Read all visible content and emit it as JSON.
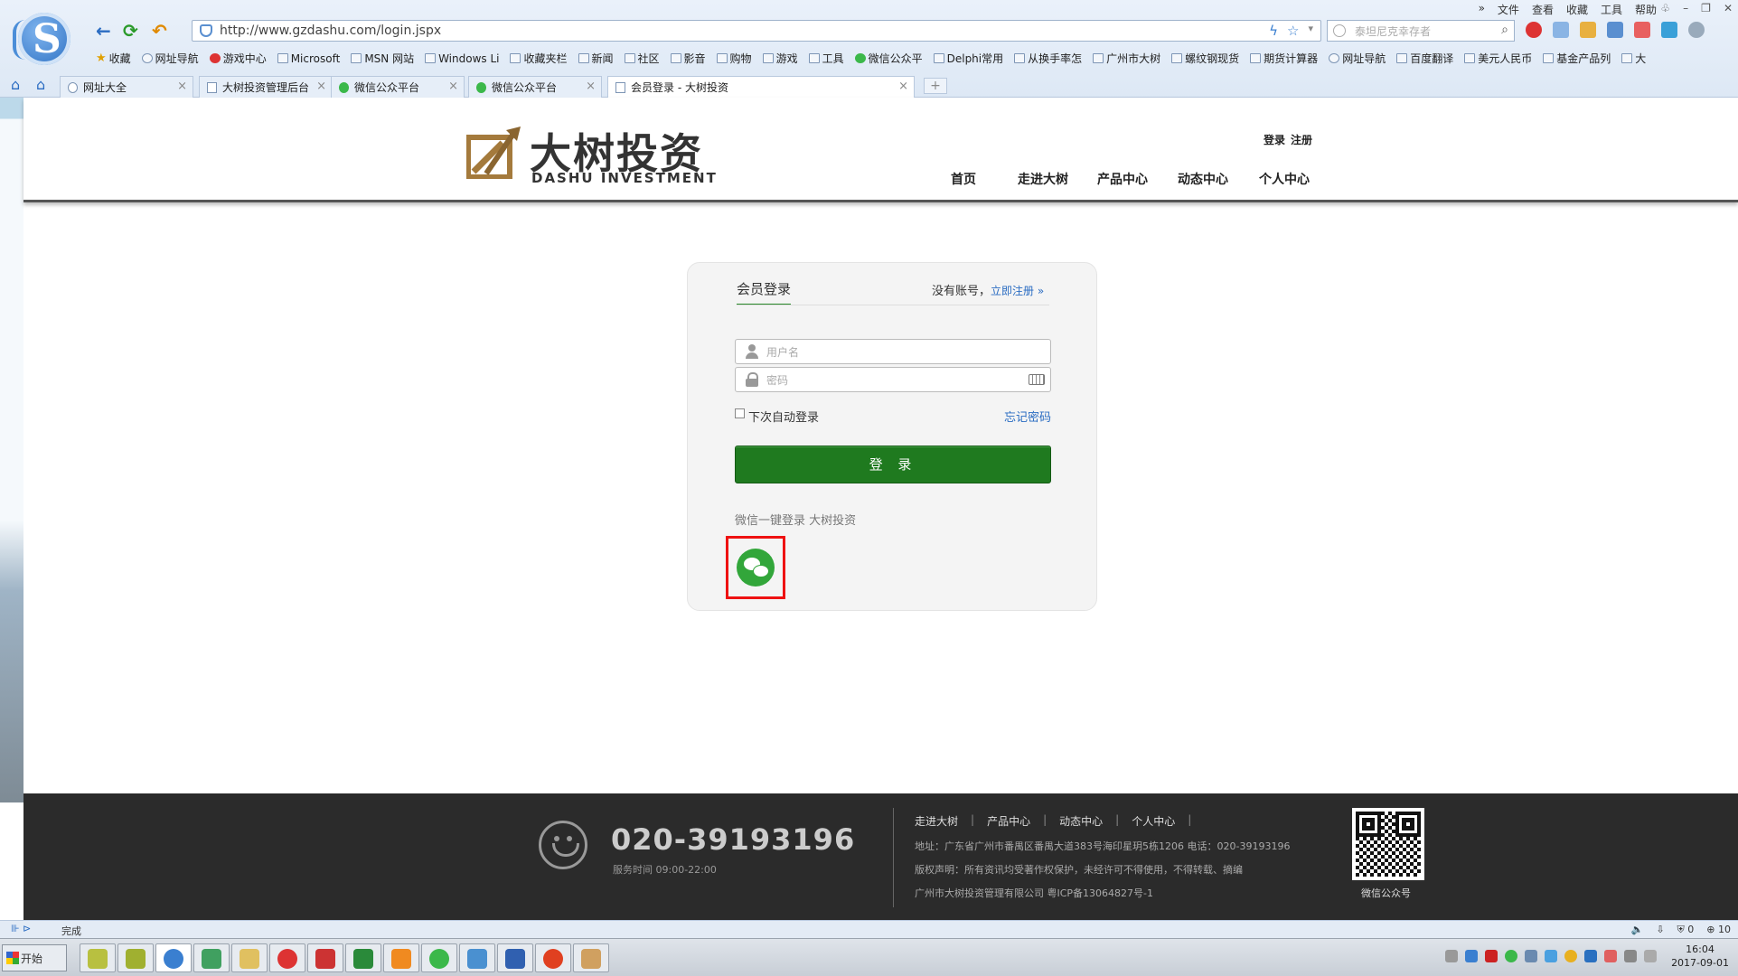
{
  "browser": {
    "menu": [
      "»",
      "文件",
      "查看",
      "收藏",
      "工具",
      "帮助"
    ],
    "url": "http://www.gzdashu.com/login.jspx",
    "search_placeholder": "泰坦尼克幸存者",
    "favorites": [
      {
        "label": "收藏",
        "icon": "star-icon"
      },
      {
        "label": "网址导航",
        "icon": "globe-icon"
      },
      {
        "label": "游戏中心",
        "icon": "game-icon"
      },
      {
        "label": "Microsoft",
        "icon": "folder-icon"
      },
      {
        "label": "MSN 网站",
        "icon": "folder-icon"
      },
      {
        "label": "Windows Li",
        "icon": "folder-icon"
      },
      {
        "label": "收藏夹栏",
        "icon": "folder-icon"
      },
      {
        "label": "新闻",
        "icon": "folder-icon"
      },
      {
        "label": "社区",
        "icon": "folder-icon"
      },
      {
        "label": "影音",
        "icon": "folder-icon"
      },
      {
        "label": "购物",
        "icon": "folder-icon"
      },
      {
        "label": "游戏",
        "icon": "folder-icon"
      },
      {
        "label": "工具",
        "icon": "folder-icon"
      },
      {
        "label": "微信公众平",
        "icon": "wechat-icon"
      },
      {
        "label": "Delphi常用",
        "icon": "link-icon"
      },
      {
        "label": "从换手率怎",
        "icon": "link-icon"
      },
      {
        "label": "广州市大树",
        "icon": "page-icon"
      },
      {
        "label": "螺纹钢现货",
        "icon": "link-icon"
      },
      {
        "label": "期货计算器",
        "icon": "link-icon"
      },
      {
        "label": "网址导航",
        "icon": "globe-icon"
      },
      {
        "label": "百度翻译",
        "icon": "link-icon"
      },
      {
        "label": "美元人民币",
        "icon": "link-icon"
      },
      {
        "label": "基金产品列",
        "icon": "link-icon"
      },
      {
        "label": "大",
        "icon": "page-icon"
      }
    ],
    "tabs": [
      {
        "label": "网址大全",
        "icon": "globe-icon",
        "active": false
      },
      {
        "label": "大树投资管理后台",
        "icon": "page-icon",
        "active": false
      },
      {
        "label": "微信公众平台",
        "icon": "wechat-icon",
        "active": false
      },
      {
        "label": "微信公众平台",
        "icon": "wechat-icon",
        "active": false
      },
      {
        "label": "会员登录 - 大树投资",
        "icon": "page-icon",
        "active": true
      }
    ],
    "status": "完成",
    "status_right": [
      "0",
      "10"
    ]
  },
  "site": {
    "brand_cn": "大树投资",
    "brand_en": "DASHU INVESTMENT",
    "auth": {
      "login": "登录",
      "register": "注册"
    },
    "nav": [
      "首页",
      "走进大树",
      "产品中心",
      "动态中心",
      "个人中心"
    ]
  },
  "login": {
    "title": "会员登录",
    "no_account": "没有账号，",
    "register_link": "立即注册 »",
    "username_placeholder": "用户名",
    "password_placeholder": "密码",
    "remember": "下次自动登录",
    "forgot": "忘记密码",
    "submit": "登 录",
    "wechat_hint": "微信一键登录 大树投资"
  },
  "footer": {
    "phone": "020-39193196",
    "hours": "服务时间 09:00-22:00",
    "links": [
      "走进大树",
      "产品中心",
      "动态中心",
      "个人中心"
    ],
    "address": "地址：广东省广州市番禺区番禺大道383号海印星玥5栋1206 电话：020-39193196",
    "copyright": "版权声明：所有资讯均受著作权保护，未经许可不得使用，不得转载、摘编",
    "company": "广州市大树投资管理有限公司 粤ICP备13064827号-1",
    "qr_label": "微信公众号"
  },
  "taskbar": {
    "start": "开始",
    "clock_time": "16:04",
    "clock_date": "2017-09-01"
  }
}
